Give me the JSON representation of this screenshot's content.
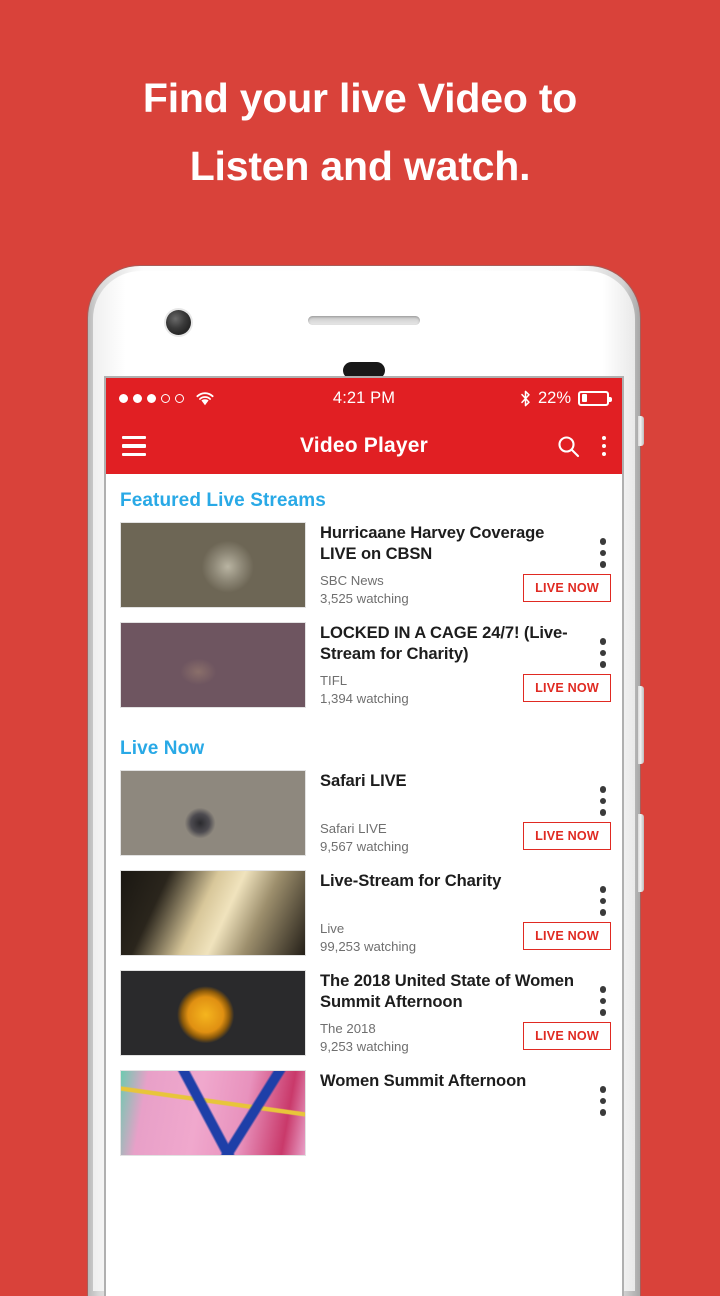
{
  "headline": {
    "line1": "Find your live Video to",
    "line2": "Listen and watch."
  },
  "colors": {
    "background_red": "#D9423A",
    "appbar_red": "#E11F23",
    "section_blue": "#29A9E6",
    "live_badge_red": "#E02A22"
  },
  "status_bar": {
    "signal_filled": 3,
    "signal_total": 5,
    "wifi_icon": "wifi-icon",
    "time": "4:21 PM",
    "bluetooth_icon": "bluetooth-icon",
    "battery_percent": "22%",
    "battery_level": 22
  },
  "app_bar": {
    "menu_icon": "hamburger-menu-icon",
    "title": "Video Player",
    "search_icon": "search-icon",
    "overflow_icon": "overflow-menu-icon"
  },
  "sections": [
    {
      "title": "Featured Live Streams",
      "items": [
        {
          "title": "Hurricaane Harvey Coverage LIVE on CBSN",
          "channel": "SBC News",
          "viewers": "3,525 watching",
          "badge": "LIVE NOW",
          "thumb_class": "t-loco",
          "thumb_name": "thumbnail-locomotive"
        },
        {
          "title": "LOCKED IN A CAGE 24/7! (Live-Stream for Charity)",
          "channel": "TIFL",
          "viewers": "1,394 watching",
          "badge": "LIVE NOW",
          "thumb_class": "t-cubist",
          "thumb_name": "thumbnail-cubist-painting"
        }
      ]
    },
    {
      "title": "Live Now",
      "items": [
        {
          "title": "Safari LIVE",
          "channel": "Safari LIVE",
          "viewers": "9,567 watching",
          "badge": "LIVE NOW",
          "thumb_class": "t-camera",
          "thumb_name": "thumbnail-vintage-camera"
        },
        {
          "title": "Live-Stream for Charity",
          "channel": "Live",
          "viewers": "99,253 watching",
          "badge": "LIVE NOW",
          "thumb_class": "t-cross",
          "thumb_name": "thumbnail-crucifix"
        },
        {
          "title": "The 2018 United State of Women Summit Afternoon",
          "channel": "The 2018",
          "viewers": "9,253 watching",
          "badge": "LIVE NOW",
          "thumb_class": "t-apple",
          "thumb_name": "thumbnail-apple-logo"
        },
        {
          "title": "Women Summit Afternoon",
          "channel": "",
          "viewers": "",
          "badge": "",
          "thumb_class": "t-abstract",
          "thumb_name": "thumbnail-abstract-art"
        }
      ]
    }
  ]
}
